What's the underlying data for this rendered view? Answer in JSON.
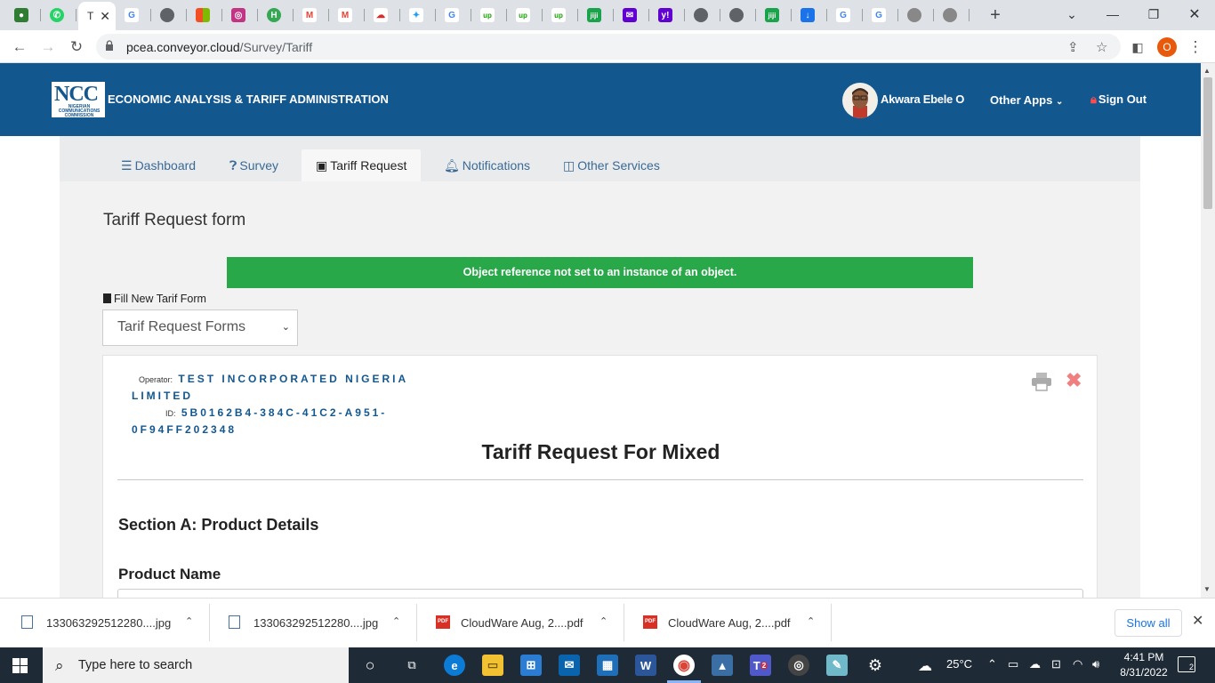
{
  "browser": {
    "active_tab_title": "T",
    "url_host": "pcea.conveyor.cloud",
    "url_path": "/Survey/Tariff",
    "profile_initial": "O"
  },
  "tabs": [
    {
      "icon": "ncc-favicon-icon",
      "color": "#2e7d32"
    },
    {
      "icon": "whatsapp-icon",
      "color": "#25d366"
    },
    {
      "icon": "active-tab",
      "color": "#ffffff"
    },
    {
      "icon": "google-icon",
      "color": "#4285f4"
    },
    {
      "icon": "globe-icon",
      "color": "#5f6368"
    },
    {
      "icon": "microsoft-icon",
      "color": "#f25022"
    },
    {
      "icon": "instagram-icon",
      "color": "#c13584"
    },
    {
      "icon": "app-icon",
      "color": "#34a853"
    },
    {
      "icon": "gmail-icon",
      "color": "#ea4335"
    },
    {
      "icon": "gmail-icon",
      "color": "#ea4335"
    },
    {
      "icon": "cloud-icon",
      "color": "#d32f2f"
    },
    {
      "icon": "twitter-icon",
      "color": "#1da1f2"
    },
    {
      "icon": "google-icon",
      "color": "#4285f4"
    },
    {
      "icon": "upwork-icon",
      "color": "#14a800"
    },
    {
      "icon": "upwork-icon",
      "color": "#14a800"
    },
    {
      "icon": "upwork-icon",
      "color": "#14a800"
    },
    {
      "icon": "jiji-icon",
      "color": "#1aa34a"
    },
    {
      "icon": "mail-icon",
      "color": "#6001d2"
    },
    {
      "icon": "yahoo-icon",
      "color": "#6001d2"
    },
    {
      "icon": "globe-icon",
      "color": "#5f6368"
    },
    {
      "icon": "globe-icon",
      "color": "#5f6368"
    },
    {
      "icon": "jiji-icon",
      "color": "#1aa34a"
    },
    {
      "icon": "download-icon",
      "color": "#1a73e8"
    },
    {
      "icon": "google-icon",
      "color": "#4285f4"
    },
    {
      "icon": "google-icon",
      "color": "#4285f4"
    },
    {
      "icon": "globe-icon",
      "color": "#5f6368"
    },
    {
      "icon": "globe-icon",
      "color": "#5f6368"
    }
  ],
  "header": {
    "logo_text": "NCC",
    "logo_subtext": "NIGERIAN COMMUNICATIONS COMMISSION",
    "site_title": "ECONOMIC ANALYSIS & TARIFF ADMINISTRATION",
    "user_name": "Akwara Ebele O",
    "other_apps": "Other Apps",
    "sign_out": "Sign Out",
    "brand_color": "#13578f"
  },
  "nav": {
    "dashboard": "Dashboard",
    "survey": "Survey",
    "tariff_request": "Tariff Request",
    "notifications": "Notifications",
    "other_services": "Other Services"
  },
  "form": {
    "title": "Tariff Request form",
    "alert": "Object reference not set to an instance of an object.",
    "fill_label": "Fill New Tarif Form",
    "select_value": "Tarif Request Forms"
  },
  "card": {
    "operator_label": "Operator:",
    "operator_value_1": "TEST INCORPORATED NIGERIA",
    "operator_value_2": "LIMITED",
    "id_label": "ID:",
    "id_value_1": "5B0162B4-384C-41C2-A951-",
    "id_value_2": "0F94FF202348",
    "title": "Tariff Request For Mixed",
    "section_a": "Section A: Product Details",
    "product_name_label": "Product Name"
  },
  "downloads": [
    {
      "name": "133063292512280....jpg",
      "type": "jpg"
    },
    {
      "name": "133063292512280....jpg",
      "type": "jpg"
    },
    {
      "name": "CloudWare Aug, 2....pdf",
      "type": "pdf"
    },
    {
      "name": "CloudWare Aug, 2....pdf",
      "type": "pdf"
    }
  ],
  "downloads_show_all": "Show all",
  "taskbar": {
    "search_placeholder": "Type here to search",
    "temperature": "25°C",
    "time": "4:41 PM",
    "date": "8/31/2022",
    "notification_count": "2",
    "teams_badge": "2"
  }
}
